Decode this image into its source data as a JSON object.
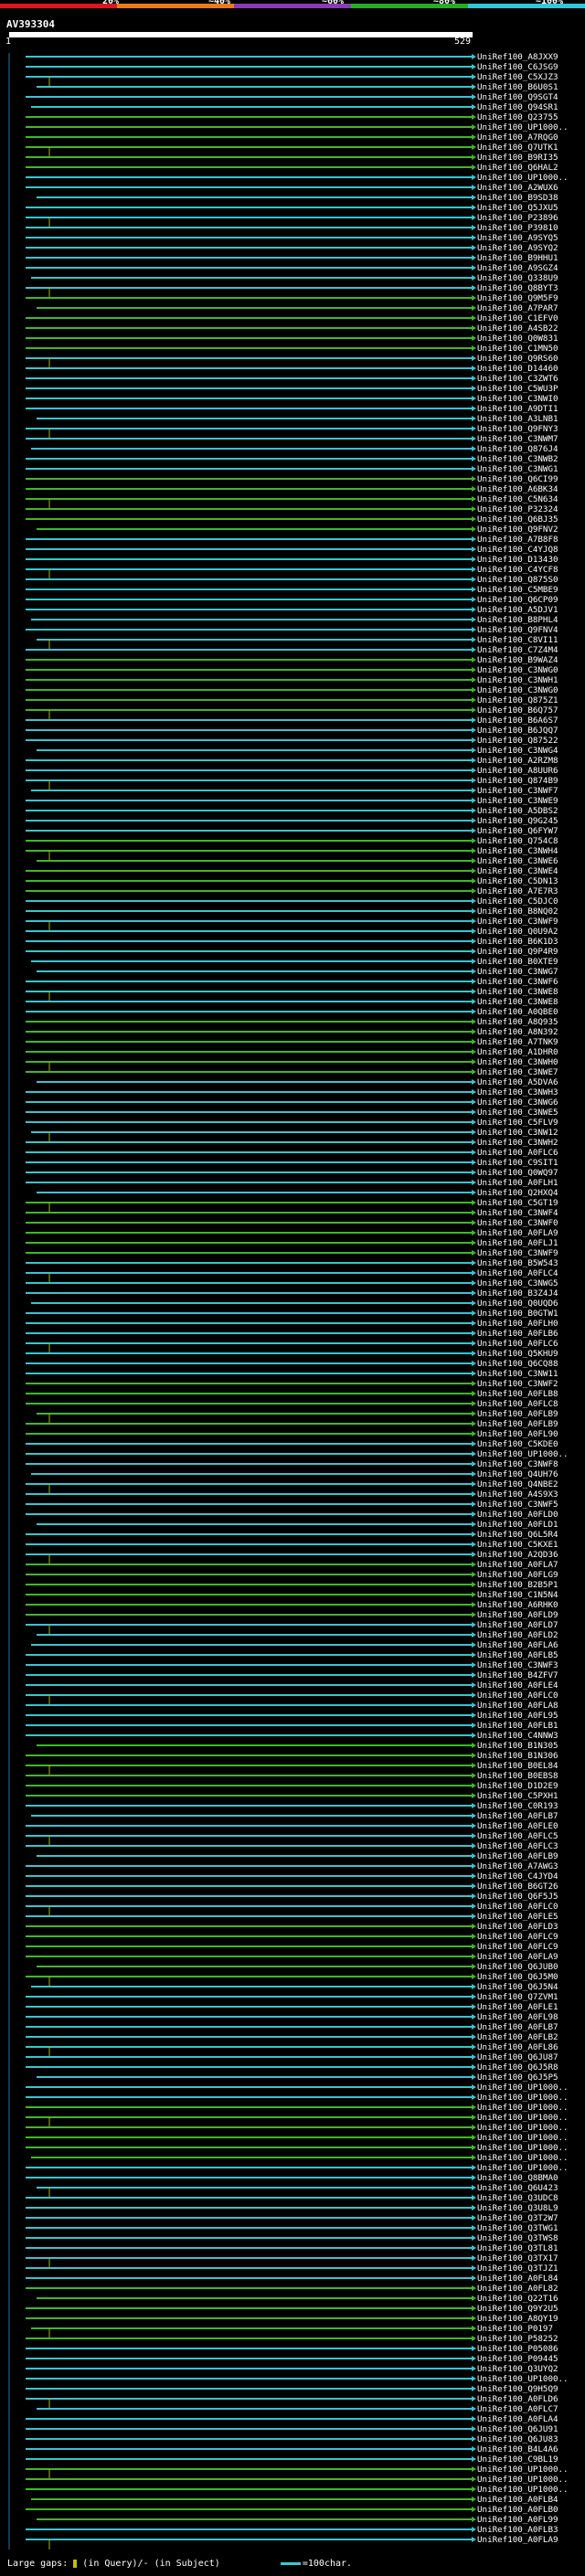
{
  "legend": {
    "labels": [
      "20%",
      "~40%",
      "~60%",
      "~80%",
      "~100%"
    ],
    "colors": [
      "#e0141c",
      "#ee7a14",
      "#8a3ab8",
      "#22b022",
      "#2ec8dc"
    ]
  },
  "query": {
    "id": "AV393304",
    "start": "1",
    "end": "529"
  },
  "colors": {
    "high": "#37c5cf",
    "mid": "#3fb828",
    "gap": "#b0b020",
    "dot": "#c8c850"
  },
  "hits": [
    "UniRef100_A8JXX9",
    "UniRef100_C6JSG9",
    "UniRef100_C5XJZ3",
    "UniRef100_B6U0S1",
    "UniRef100_Q9SGT4",
    "UniRef100_Q94SR1",
    "UniRef100_Q23755",
    "UniRef100_UP1000..",
    "UniRef100_A7RQG0",
    "UniRef100_Q7UTK1",
    "UniRef100_B9RI35",
    "UniRef100_Q6HAL2",
    "UniRef100_UP1000..",
    "UniRef100_A2WUX6",
    "UniRef100_B9SD38",
    "UniRef100_Q5JXU5",
    "UniRef100_P23896",
    "UniRef100_P39810",
    "UniRef100_A9SYQ5",
    "UniRef100_A9SYQ2",
    "UniRef100_B9HHU1",
    "UniRef100_A9SGZ4",
    "UniRef100_Q338U9",
    "UniRef100_Q8BYT3",
    "UniRef100_Q9M5F9",
    "UniRef100_A7PAR7",
    "UniRef100_C1EFV0",
    "UniRef100_A4SB22",
    "UniRef100_Q0W831",
    "UniRef100_C1MN50",
    "UniRef100_Q9RS60",
    "UniRef100_D14460",
    "UniRef100_C3ZWT6",
    "UniRef100_C5WU3P",
    "UniRef100_C3NWI0",
    "UniRef100_A9DTI1",
    "UniRef100_A3LNB1",
    "UniRef100_Q9FNY3",
    "UniRef100_C3NWM7",
    "UniRef100_Q876J4",
    "UniRef100_C3NWB2",
    "UniRef100_C3NWG1",
    "UniRef100_Q6CI99",
    "UniRef100_A6BK34",
    "UniRef100_C5N634",
    "UniRef100_P32324",
    "UniRef100_Q6BJ35",
    "UniRef100_Q9FNV2",
    "UniRef100_A7B8F8",
    "UniRef100_C4YJQ8",
    "UniRef100_D13430",
    "UniRef100_C4YCF8",
    "UniRef100_Q875S0",
    "UniRef100_C5MBE9",
    "UniRef100_Q6CP09",
    "UniRef100_A5DJV1",
    "UniRef100_B8PHL4",
    "UniRef100_Q9FNV4",
    "UniRef100_C8VI11",
    "UniRef100_C7Z4M4",
    "UniRef100_B9WAZ4",
    "UniRef100_C3NWG0",
    "UniRef100_C3NWH1",
    "UniRef100_C3NWG0",
    "UniRef100_Q875Z1",
    "UniRef100_B6Q757",
    "UniRef100_B6A6S7",
    "UniRef100_B6JQQ7",
    "UniRef100_Q87522",
    "UniRef100_C3NWG4",
    "UniRef100_A2RZM8",
    "UniRef100_A8UUR6",
    "UniRef100_Q874B9",
    "UniRef100_C3NWF7",
    "UniRef100_C3NWE9",
    "UniRef100_A5DBS2",
    "UniRef100_Q9G245",
    "UniRef100_Q6FYW7",
    "UniRef100_Q754C8",
    "UniRef100_C3NWH4",
    "UniRef100_C3NWE6",
    "UniRef100_C3NWE4",
    "UniRef100_C5DN13",
    "UniRef100_A7E7R3",
    "UniRef100_C5DJC0",
    "UniRef100_B8NQ02",
    "UniRef100_C3NWF9",
    "UniRef100_Q0U9A2",
    "UniRef100_B6K1D3",
    "UniRef100_Q9P4R9",
    "UniRef100_B0XTE9",
    "UniRef100_C3NWG7",
    "UniRef100_C3NWF6",
    "UniRef100_C3NWE8",
    "UniRef100_C3NWE8",
    "UniRef100_A0QBE0",
    "UniRef100_A8Q935",
    "UniRef100_A8N392",
    "UniRef100_A7TNK9",
    "UniRef100_A1DHR0",
    "UniRef100_C3NWH0",
    "UniRef100_C3NWE7",
    "UniRef100_A5DVA6",
    "UniRef100_C3NWH3",
    "UniRef100_C3NWG6",
    "UniRef100_C3NWE5",
    "UniRef100_C5FLV9",
    "UniRef100_C3NW12",
    "UniRef100_C3NWH2",
    "UniRef100_A0FLC6",
    "UniRef100_C9SIT1",
    "UniRef100_Q0WQ97",
    "UniRef100_A0FLH1",
    "UniRef100_Q2HXQ4",
    "UniRef100_C5GT19",
    "UniRef100_C3NWF4",
    "UniRef100_C3NWF0",
    "UniRef100_A0FLA9",
    "UniRef100_A0FLJ1",
    "UniRef100_C3NWF9",
    "UniRef100_B5W543",
    "UniRef100_A0FLC4",
    "UniRef100_C3NWG5",
    "UniRef100_B3Z4J4",
    "UniRef100_Q0UQD6",
    "UniRef100_B0GTW1",
    "UniRef100_A0FLH0",
    "UniRef100_A0FLB6",
    "UniRef100_A0FLC6",
    "UniRef100_Q5KHU9",
    "UniRef100_Q6CQ88",
    "UniRef100_C3NW11",
    "UniRef100_C3NWF2",
    "UniRef100_A0FLB8",
    "UniRef100_A0FLC8",
    "UniRef100_A0FLB9",
    "UniRef100_A0FLB9",
    "UniRef100_A0FL90",
    "UniRef100_C5KDE0",
    "UniRef100_UP1000..",
    "UniRef100_C3NWF8",
    "UniRef100_Q4UH76",
    "UniRef100_Q4NBE2",
    "UniRef100_A4S9X3",
    "UniRef100_C3NWF5",
    "UniRef100_A0FLD0",
    "UniRef100_A0FLD1",
    "UniRef100_Q6L5R4",
    "UniRef100_C5KXE1",
    "UniRef100_A2QD36",
    "UniRef100_A0FLA7",
    "UniRef100_A0FLG9",
    "UniRef100_B2B5P1",
    "UniRef100_C1N5N4",
    "UniRef100_A6RHK0",
    "UniRef100_A0FLD9",
    "UniRef100_A0FLD7",
    "UniRef100_A0FLD2",
    "UniRef100_A0FLA6",
    "UniRef100_A0FLB5",
    "UniRef100_C3NWF3",
    "UniRef100_B4ZFV7",
    "UniRef100_A0FLE4",
    "UniRef100_A0FLC0",
    "UniRef100_A0FLA8",
    "UniRef100_A0FL95",
    "UniRef100_A0FLB1",
    "UniRef100_C4NNW3",
    "UniRef100_B1N305",
    "UniRef100_B1N306",
    "UniRef100_B0EL84",
    "UniRef100_B0EBS8",
    "UniRef100_D1D2E9",
    "UniRef100_C5PXH1",
    "UniRef100_C0R193",
    "UniRef100_A0FLB7",
    "UniRef100_A0FLE0",
    "UniRef100_A0FLC5",
    "UniRef100_A0FLC3",
    "UniRef100_A0FLB9",
    "UniRef100_A7AWG3",
    "UniRef100_C4JYD4",
    "UniRef100_B6GT26",
    "UniRef100_Q6F5J5",
    "UniRef100_A0FLC0",
    "UniRef100_A0FLE5",
    "UniRef100_A0FLD3",
    "UniRef100_A0FLC9",
    "UniRef100_A0FLC9",
    "UniRef100_A0FLA9",
    "UniRef100_Q6JUB0",
    "UniRef100_Q6J5M0",
    "UniRef100_Q6J5N4",
    "UniRef100_Q7ZVM1",
    "UniRef100_A0FLE1",
    "UniRef100_A0FL98",
    "UniRef100_A0FLB7",
    "UniRef100_A0FLB2",
    "UniRef100_A0FL86",
    "UniRef100_Q6JU87",
    "UniRef100_Q6J5R8",
    "UniRef100_Q6J5P5",
    "UniRef100_UP1000..",
    "UniRef100_UP1000..",
    "UniRef100_UP1000..",
    "UniRef100_UP1000..",
    "UniRef100_UP1000..",
    "UniRef100_UP1000..",
    "UniRef100_UP1000..",
    "UniRef100_UP1000..",
    "UniRef100_UP1000..",
    "UniRef100_Q8BMA0",
    "UniRef100_Q6U423",
    "UniRef100_Q3UDC8",
    "UniRef100_Q3U8L9",
    "UniRef100_Q3T2W7",
    "UniRef100_Q3TWG1",
    "UniRef100_Q3TWS8",
    "UniRef100_Q3TL81",
    "UniRef100_Q3TX17",
    "UniRef100_Q3TJZ1",
    "UniRef100_A0FL84",
    "UniRef100_A0FL82",
    "UniRef100_Q22T16",
    "UniRef100_Q9Y2U5",
    "UniRef100_A8QY19",
    "UniRef100_P0197",
    "UniRef100_P58252",
    "UniRef100_P05086",
    "UniRef100_P09445",
    "UniRef100_Q3UYQ2",
    "UniRef100_UP1000..",
    "UniRef100_Q9H5Q9",
    "UniRef100_A0FLD6",
    "UniRef100_A0FLC7",
    "UniRef100_A0FLA4",
    "UniRef100_Q6JU91",
    "UniRef100_Q6JU83",
    "UniRef100_B4L4A6",
    "UniRef100_C9BL19",
    "UniRef100_UP1000..",
    "UniRef100_UP1000..",
    "UniRef100_UP1000..",
    "UniRef100_A0FLB4",
    "UniRef100_A0FLB0",
    "UniRef100_A0FL99",
    "UniRef100_A0FLB3",
    "UniRef100_A0FLA9"
  ],
  "footer": {
    "gaps_label": "Large gaps:",
    "query_gap": "(in Query)/-",
    "subject_gap": "(in Subject)",
    "scale_label": "=100char."
  }
}
